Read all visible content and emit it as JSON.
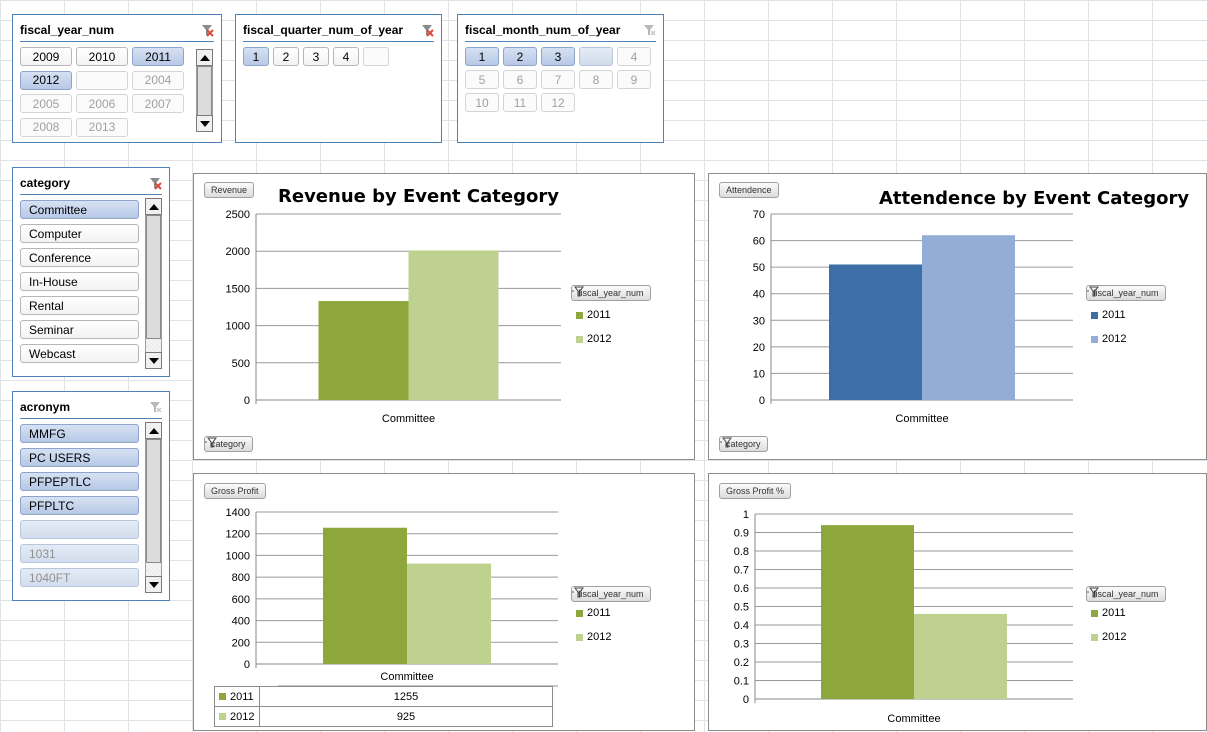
{
  "slicers": {
    "fiscal_year": {
      "title": "fiscal_year_num",
      "items": [
        {
          "label": "2009",
          "selected": false,
          "nodata": false
        },
        {
          "label": "2010",
          "selected": false,
          "nodata": false
        },
        {
          "label": "2011",
          "selected": true,
          "nodata": false
        },
        {
          "label": "2012",
          "selected": true,
          "nodata": false
        },
        {
          "label": "",
          "selected": false,
          "nodata": true
        },
        {
          "label": "2004",
          "selected": false,
          "nodata": true
        },
        {
          "label": "2005",
          "selected": false,
          "nodata": true
        },
        {
          "label": "2006",
          "selected": false,
          "nodata": true
        },
        {
          "label": "2007",
          "selected": false,
          "nodata": true
        },
        {
          "label": "2008",
          "selected": false,
          "nodata": true
        },
        {
          "label": "2013",
          "selected": false,
          "nodata": true
        }
      ]
    },
    "fiscal_quarter": {
      "title": "fiscal_quarter_num_of_year",
      "items": [
        {
          "label": "1",
          "selected": true,
          "nodata": false
        },
        {
          "label": "2",
          "selected": false,
          "nodata": false
        },
        {
          "label": "3",
          "selected": false,
          "nodata": false
        },
        {
          "label": "4",
          "selected": false,
          "nodata": false
        },
        {
          "label": "",
          "selected": false,
          "nodata": true
        }
      ]
    },
    "fiscal_month": {
      "title": "fiscal_month_num_of_year",
      "items": [
        {
          "label": "1",
          "selected": true,
          "nodata": false
        },
        {
          "label": "2",
          "selected": true,
          "nodata": false
        },
        {
          "label": "3",
          "selected": true,
          "nodata": false
        },
        {
          "label": "",
          "selected": true,
          "nodata": true
        },
        {
          "label": "4",
          "selected": false,
          "nodata": true
        },
        {
          "label": "5",
          "selected": false,
          "nodata": true
        },
        {
          "label": "6",
          "selected": false,
          "nodata": true
        },
        {
          "label": "7",
          "selected": false,
          "nodata": true
        },
        {
          "label": "8",
          "selected": false,
          "nodata": true
        },
        {
          "label": "9",
          "selected": false,
          "nodata": true
        },
        {
          "label": "10",
          "selected": false,
          "nodata": true
        },
        {
          "label": "11",
          "selected": false,
          "nodata": true
        },
        {
          "label": "12",
          "selected": false,
          "nodata": true
        }
      ]
    },
    "category": {
      "title": "category",
      "items": [
        {
          "label": "Committee",
          "selected": true,
          "nodata": false
        },
        {
          "label": "Computer",
          "selected": false,
          "nodata": false
        },
        {
          "label": "Conference",
          "selected": false,
          "nodata": false
        },
        {
          "label": "In-House",
          "selected": false,
          "nodata": false
        },
        {
          "label": "Rental",
          "selected": false,
          "nodata": false
        },
        {
          "label": "Seminar",
          "selected": false,
          "nodata": false
        },
        {
          "label": "Webcast",
          "selected": false,
          "nodata": false
        }
      ]
    },
    "acronym": {
      "title": "acronym",
      "items": [
        {
          "label": "MMFG",
          "selected": true,
          "nodata": false
        },
        {
          "label": "PC USERS",
          "selected": true,
          "nodata": false
        },
        {
          "label": "PFPEPTLC",
          "selected": true,
          "nodata": false
        },
        {
          "label": "PFPLTC",
          "selected": true,
          "nodata": false
        },
        {
          "label": "",
          "selected": true,
          "nodata": true
        },
        {
          "label": "1031",
          "selected": true,
          "nodata": true
        },
        {
          "label": "1040FT",
          "selected": true,
          "nodata": true
        }
      ]
    }
  },
  "colors": {
    "green_2011": "#8ea73c",
    "green_2012": "#bfd18e",
    "blue_2011": "#3c6ea7",
    "blue_2012": "#93aed6",
    "slicer_border": "#4f81bd",
    "clear_filter_active": "#d94a3a"
  },
  "chart_data": [
    {
      "type": "bar",
      "title": "Revenue by Event Category",
      "field_button": "Revenue",
      "axis_field_button": "category",
      "legend_title": "fiscal_year_num",
      "categories": [
        "Committee"
      ],
      "series": [
        {
          "name": "2011",
          "values": [
            1330
          ]
        },
        {
          "name": "2012",
          "values": [
            2010
          ]
        }
      ],
      "ylim": [
        0,
        2500
      ],
      "yticks": [
        0,
        500,
        1000,
        1500,
        2000,
        2500
      ],
      "legend_position": "right",
      "grid": true
    },
    {
      "type": "bar",
      "title": "Attendence by Event Category",
      "field_button": "Attendence",
      "axis_field_button": "category",
      "legend_title": "fiscal_year_num",
      "categories": [
        "Committee"
      ],
      "series": [
        {
          "name": "2011",
          "values": [
            51
          ]
        },
        {
          "name": "2012",
          "values": [
            62
          ]
        }
      ],
      "ylim": [
        0,
        70
      ],
      "yticks": [
        0,
        10,
        20,
        30,
        40,
        50,
        60,
        70
      ],
      "legend_position": "right",
      "grid": true
    },
    {
      "type": "bar",
      "title": "",
      "field_button": "Gross Profit",
      "legend_title": "fiscal_year_num",
      "categories": [
        "Committee"
      ],
      "series": [
        {
          "name": "2011",
          "values": [
            1255
          ]
        },
        {
          "name": "2012",
          "values": [
            925
          ]
        }
      ],
      "ylim": [
        0,
        1400
      ],
      "yticks": [
        0,
        200,
        400,
        600,
        800,
        1000,
        1200,
        1400
      ],
      "legend_position": "right",
      "grid": true,
      "data_table": [
        {
          "label": "2011",
          "value": "1255"
        },
        {
          "label": "2012",
          "value": "925"
        }
      ]
    },
    {
      "type": "bar",
      "title": "",
      "field_button": "Gross Profit %",
      "legend_title": "fiscal_year_num",
      "categories": [
        "Committee"
      ],
      "series": [
        {
          "name": "2011",
          "values": [
            0.94
          ]
        },
        {
          "name": "2012",
          "values": [
            0.46
          ]
        }
      ],
      "ylim": [
        0,
        1
      ],
      "yticks": [
        "0",
        "0.1",
        "0.2",
        "0.3",
        "0.4",
        "0.5",
        "0.6",
        "0.7",
        "0.8",
        "0.9",
        "1"
      ],
      "legend_position": "right",
      "grid": true
    }
  ]
}
